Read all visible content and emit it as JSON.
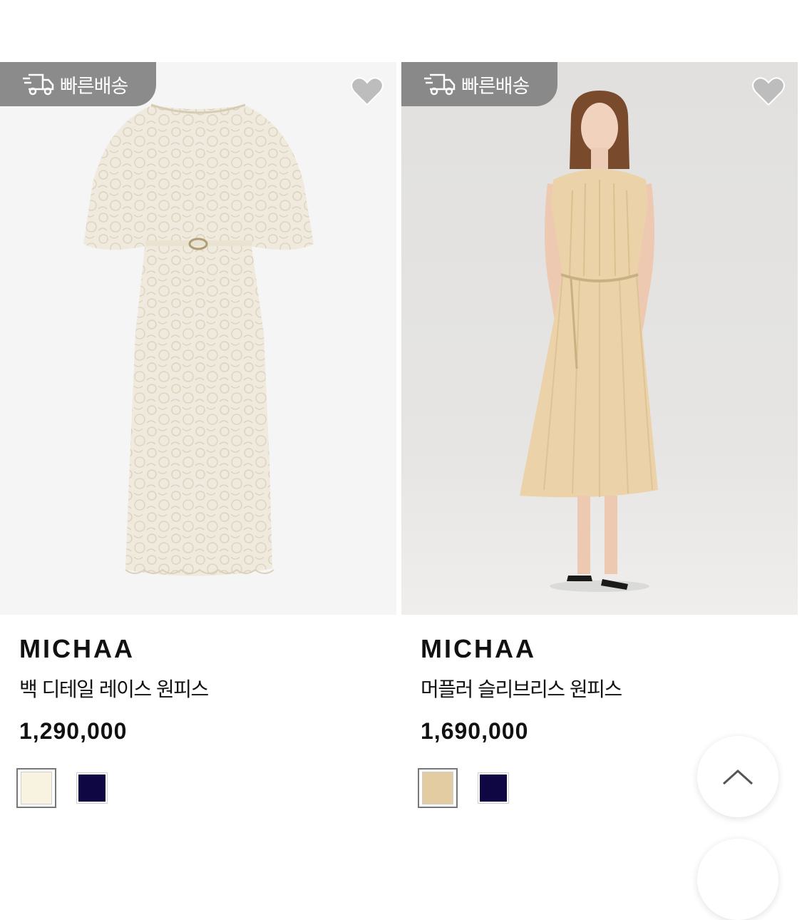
{
  "badge_label": "빠른배송",
  "products": [
    {
      "brand": "MICHAA",
      "name": "백 디테일 레이스 원피스",
      "price": "1,290,000",
      "colors": [
        "#f8f2e0",
        "#0f0744"
      ],
      "selected_color": 0
    },
    {
      "brand": "MICHAA",
      "name": "머플러 슬리브리스 원피스",
      "price": "1,690,000",
      "colors": [
        "#e3cca1",
        "#0f0744"
      ],
      "selected_color": 0
    }
  ],
  "icons": {
    "badge": "fast-delivery-truck-icon",
    "wishlist": "heart-icon",
    "scroll_top": "chevron-up-icon"
  }
}
